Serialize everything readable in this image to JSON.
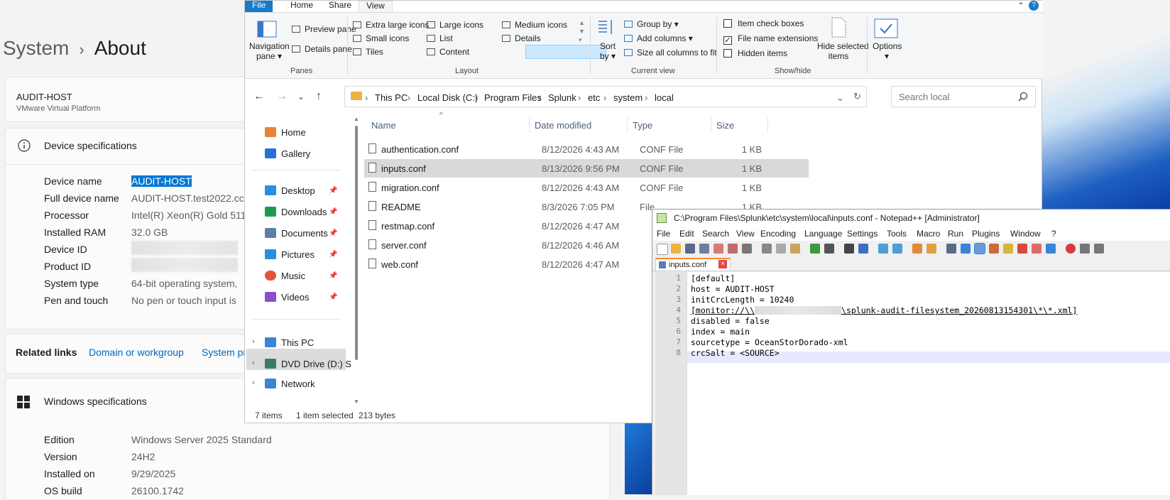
{
  "settings": {
    "crumb": "System",
    "page_title": "About",
    "host_name": "AUDIT-HOST",
    "host_model": "VMware Virtual Platform",
    "device_specs_title": "Device specifications",
    "specs": [
      {
        "key": "Device name",
        "value": "AUDIT-HOST"
      },
      {
        "key": "Full device name",
        "value": "AUDIT-HOST.test2022.cc"
      },
      {
        "key": "Processor",
        "value": "Intel(R) Xeon(R) Gold 511"
      },
      {
        "key": "Installed RAM",
        "value": "32.0 GB"
      },
      {
        "key": "Device ID",
        "value": ""
      },
      {
        "key": "Product ID",
        "value": ""
      },
      {
        "key": "System type",
        "value": "64-bit operating system,"
      },
      {
        "key": "Pen and touch",
        "value": "No pen or touch input is"
      }
    ],
    "related_label": "Related links",
    "related_links": [
      "Domain or workgroup",
      "System pr"
    ],
    "windows_specs_title": "Windows specifications",
    "win_specs": [
      {
        "key": "Edition",
        "value": "Windows Server 2025 Standard"
      },
      {
        "key": "Version",
        "value": "24H2"
      },
      {
        "key": "Installed on",
        "value": "9/29/2025"
      },
      {
        "key": "OS build",
        "value": "26100.1742"
      }
    ]
  },
  "explorer": {
    "tabs": [
      "File",
      "Home",
      "Share",
      "View"
    ],
    "active_tab": "View",
    "ribbon": {
      "panes": {
        "navigation_pane": "Navigation",
        "navigation_pane2": "pane",
        "preview_pane": "Preview pane",
        "details_pane": "Details pane",
        "group": "Panes"
      },
      "layout": {
        "items": [
          "Extra large icons",
          "Large icons",
          "Medium icons",
          "Small icons",
          "List",
          "Details",
          "Tiles",
          "Content"
        ],
        "selected": "Details",
        "group": "Layout"
      },
      "current_view": {
        "sort": "Sort",
        "sort2": "by",
        "group_by": "Group by",
        "add_columns": "Add columns",
        "size_columns": "Size all columns to fit",
        "group": "Current view"
      },
      "show_hide": {
        "item_check_boxes": "Item check boxes",
        "file_name_extensions": "File name extensions",
        "hidden_items": "Hidden items",
        "hide_selected": "Hide selected",
        "hide_selected2": "items",
        "group": "Show/hide",
        "checked": {
          "item_check_boxes": false,
          "file_name_extensions": true,
          "hidden_items": false
        }
      },
      "options": "Options"
    },
    "breadcrumb": [
      "This PC",
      "Local Disk (C:)",
      "Program Files",
      "Splunk",
      "etc",
      "system",
      "local"
    ],
    "search_placeholder": "Search local",
    "nav": [
      {
        "label": "Home",
        "color": "#e8833a"
      },
      {
        "label": "Gallery",
        "color": "#2a6fd6"
      },
      {
        "label": "Desktop",
        "color": "#2b8de0",
        "pin": true
      },
      {
        "label": "Downloads",
        "color": "#1f9a4f",
        "pin": true
      },
      {
        "label": "Documents",
        "color": "#5b7fa8",
        "pin": true
      },
      {
        "label": "Pictures",
        "color": "#2a8fdf",
        "pin": true
      },
      {
        "label": "Music",
        "color": "#e0553a",
        "pin": true
      },
      {
        "label": "Videos",
        "color": "#8a4fc9",
        "pin": true
      },
      {
        "label": "This PC",
        "color": "#3a84d8"
      },
      {
        "label": "DVD Drive (D:) S",
        "color": "#3a7d5c"
      },
      {
        "label": "Network",
        "color": "#3a84d8"
      }
    ],
    "columns": [
      "Name",
      "Date modified",
      "Type",
      "Size"
    ],
    "files": [
      {
        "name": "authentication.conf",
        "date": "8/12/2026 4:43 AM",
        "type": "CONF File",
        "size": "1 KB"
      },
      {
        "name": "inputs.conf",
        "date": "8/13/2026 9:56 PM",
        "type": "CONF File",
        "size": "1 KB"
      },
      {
        "name": "migration.conf",
        "date": "8/12/2026 4:43 AM",
        "type": "CONF File",
        "size": "1 KB"
      },
      {
        "name": "README",
        "date": "8/3/2026 7:05 PM",
        "type": "File",
        "size": "1 KB"
      },
      {
        "name": "restmap.conf",
        "date": "8/12/2026 4:47 AM",
        "type": "",
        "size": ""
      },
      {
        "name": "server.conf",
        "date": "8/12/2026 4:46 AM",
        "type": "",
        "size": ""
      },
      {
        "name": "web.conf",
        "date": "8/12/2026 4:47 AM",
        "type": "",
        "size": ""
      }
    ],
    "selected_file": "inputs.conf",
    "status": {
      "count": "7 items",
      "selection": "1 item selected",
      "bytes": "213 bytes"
    }
  },
  "notepad": {
    "title": "C:\\Program Files\\Splunk\\etc\\system\\local\\inputs.conf - Notepad++ [Administrator]",
    "menu": [
      "File",
      "Edit",
      "Search",
      "View",
      "Encoding",
      "Language",
      "Settings",
      "Tools",
      "Macro",
      "Run",
      "Plugins",
      "Window",
      "?"
    ],
    "tab": "inputs.conf",
    "lines": [
      "[default]",
      "host = AUDIT-HOST",
      "initCrcLength = 10240",
      "[monitor://\\\\",
      "disabled = false",
      "index = main",
      "sourcetype = OceanStorDorado-xml",
      "crcSalt = <SOURCE>"
    ],
    "line4_tail": "\\splunk-audit-filesystem_20260813154301\\*\\*.xml]",
    "line_numbers": [
      "1",
      "2",
      "3",
      "4",
      "5",
      "6",
      "7",
      "8"
    ]
  }
}
